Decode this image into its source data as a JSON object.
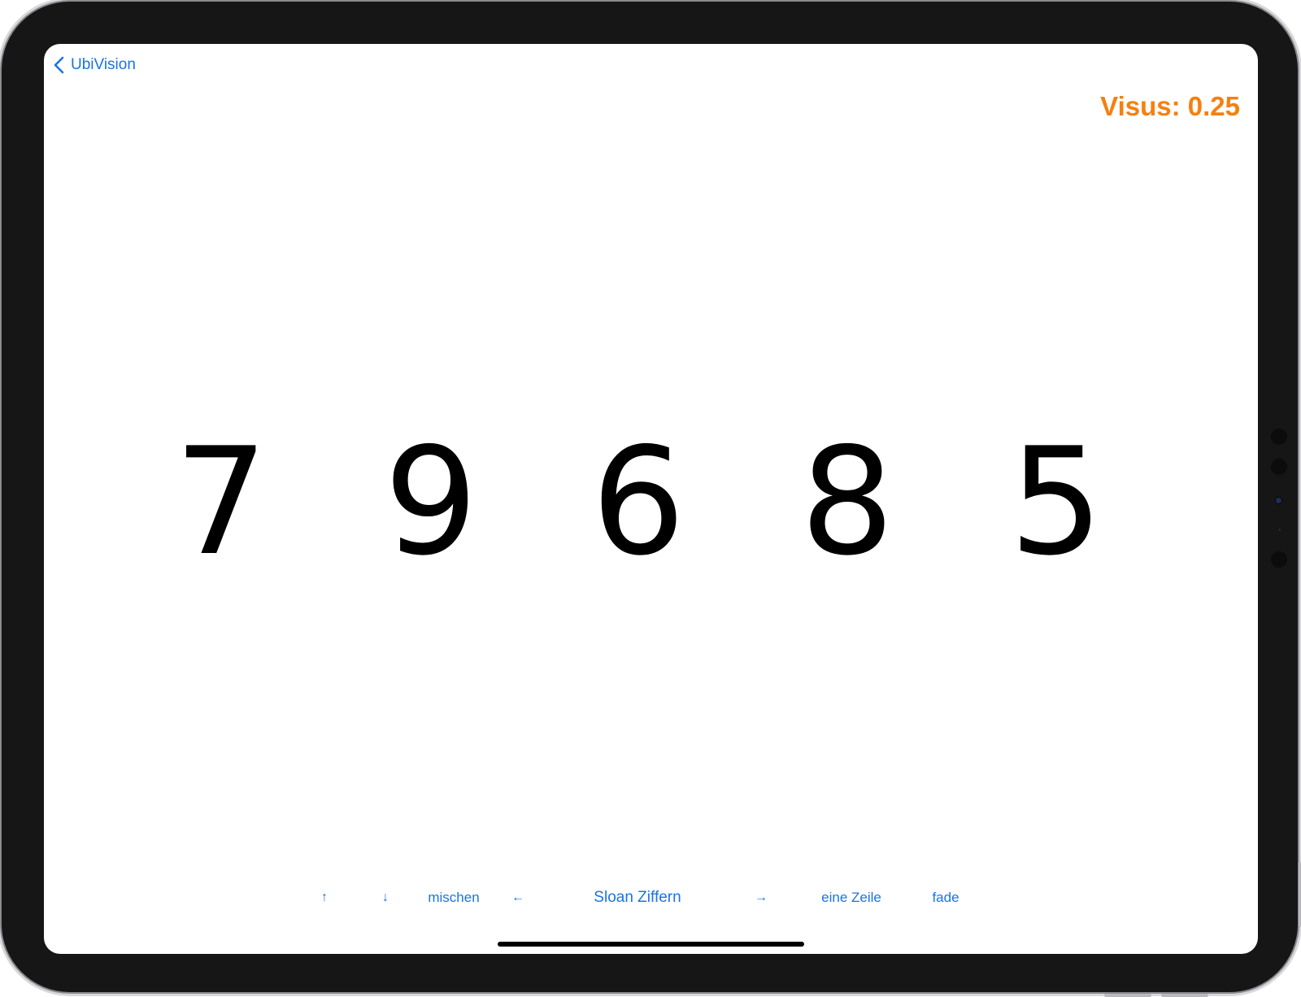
{
  "nav": {
    "back_label": "UbiVision",
    "back_icon": "chevron-left-icon"
  },
  "header": {
    "visus_text": "Visus: 0.25",
    "visus_color": "#f5800f"
  },
  "chart": {
    "digits": [
      "7",
      "9",
      "6",
      "8",
      "5"
    ]
  },
  "toolbar": {
    "up_label": "↑",
    "down_label": "↓",
    "shuffle_label": "mischen",
    "prev_label": "←",
    "title_label": "Sloan Ziffern",
    "next_label": "→",
    "single_row_label": "eine Zeile",
    "fade_label": "fade",
    "accent_color": "#1a74e4"
  }
}
